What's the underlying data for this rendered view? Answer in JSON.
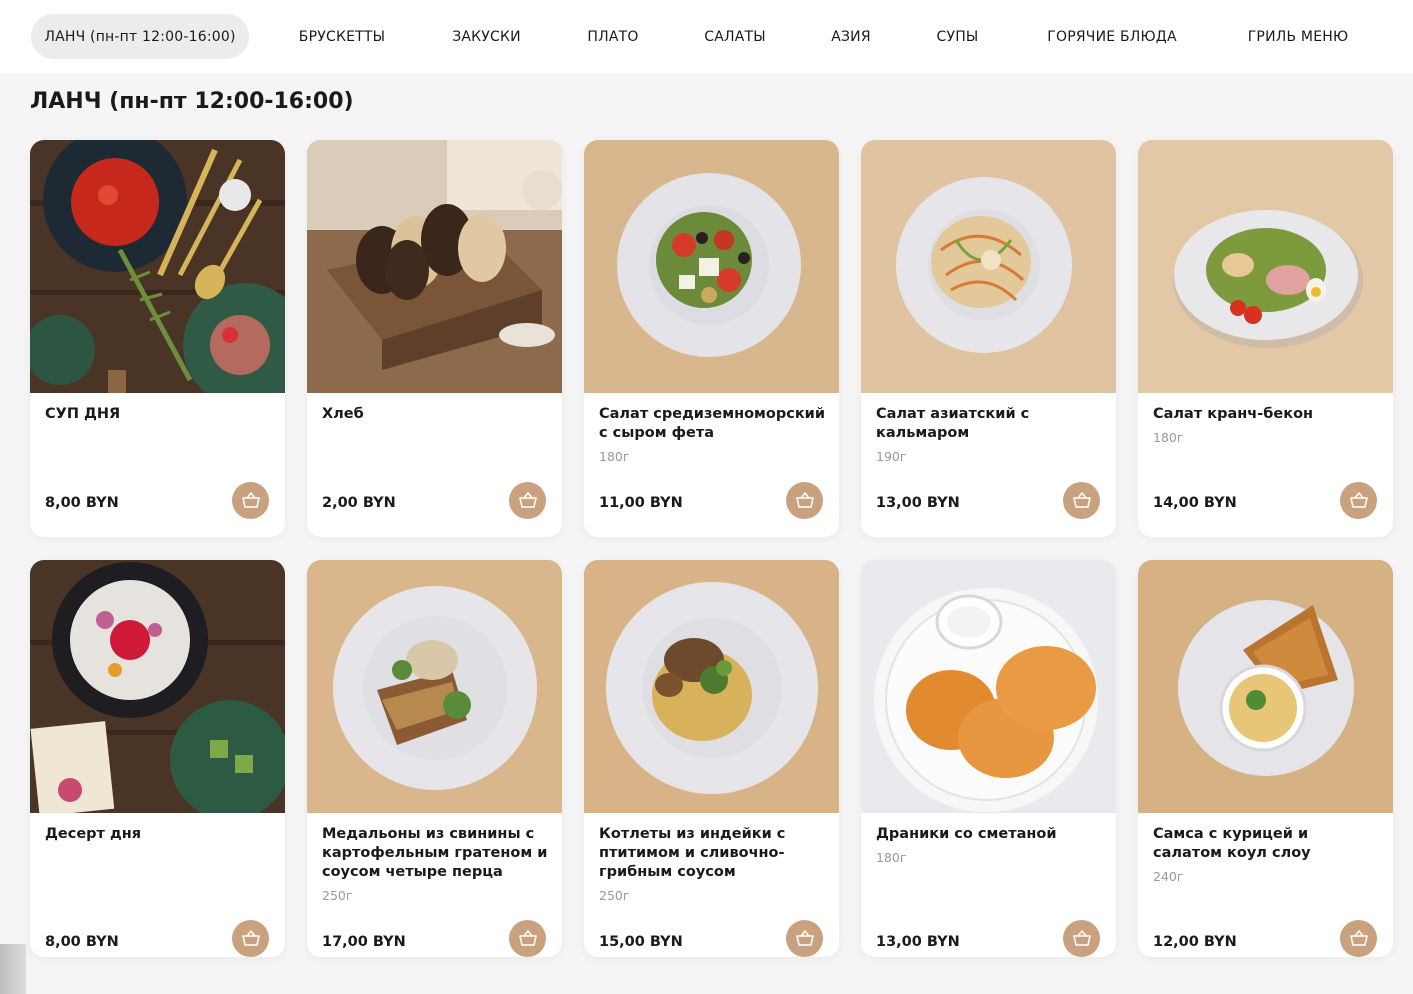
{
  "nav": {
    "tabs": [
      {
        "label": "ЛАНЧ (пн-пт 12:00-16:00)",
        "active": true
      },
      {
        "label": "БРУСКЕТТЫ"
      },
      {
        "label": "ЗАКУСКИ"
      },
      {
        "label": "ПЛАТО"
      },
      {
        "label": "САЛАТЫ"
      },
      {
        "label": "АЗИЯ"
      },
      {
        "label": "СУПЫ"
      },
      {
        "label": "ГОРЯЧИЕ БЛЮДА"
      },
      {
        "label": "ГРИЛЬ МЕНЮ"
      }
    ]
  },
  "section": {
    "title": "ЛАНЧ (пн-пт 12:00-16:00)"
  },
  "products": [
    {
      "name": "СУП ДНЯ",
      "weight": "",
      "price": "8,00 BYN",
      "photo": "soup-photo"
    },
    {
      "name": "Хлеб",
      "weight": "",
      "price": "2,00 BYN",
      "photo": "bread-photo"
    },
    {
      "name": "Салат средиземноморский с сыром фета",
      "weight": "180г",
      "price": "11,00 BYN",
      "photo": "mediterranean-salad-photo"
    },
    {
      "name": "Салат азиатский с кальмаром",
      "weight": "190г",
      "price": "13,00 BYN",
      "photo": "asian-squid-salad-photo"
    },
    {
      "name": "Салат кранч-бекон",
      "weight": "180г",
      "price": "14,00 BYN",
      "photo": "crunch-bacon-salad-photo"
    },
    {
      "name": "Десерт дня",
      "weight": "",
      "price": "8,00 BYN",
      "photo": "dessert-photo"
    },
    {
      "name": "Медальоны из свинины с картофельным гратеном и соусом четыре перца",
      "weight": "250г",
      "price": "17,00 BYN",
      "photo": "pork-medallions-photo"
    },
    {
      "name": "Котлеты из индейки с птитимом и сливочно-грибным соусом",
      "weight": "250г",
      "price": "15,00 BYN",
      "photo": "turkey-cutlets-photo"
    },
    {
      "name": "Драники со сметаной",
      "weight": "180г",
      "price": "13,00 BYN",
      "photo": "draniki-photo"
    },
    {
      "name": "Самса с курицей и салатом коул слоу",
      "weight": "240г",
      "price": "12,00 BYN",
      "photo": "samsa-photo"
    }
  ],
  "colors": {
    "accent": "#c9a17f",
    "active_tab_bg": "#ececec",
    "card_bg": "#ffffff",
    "page_bg": "#f5f5f5"
  },
  "icons": {
    "cart": "basket-icon"
  }
}
